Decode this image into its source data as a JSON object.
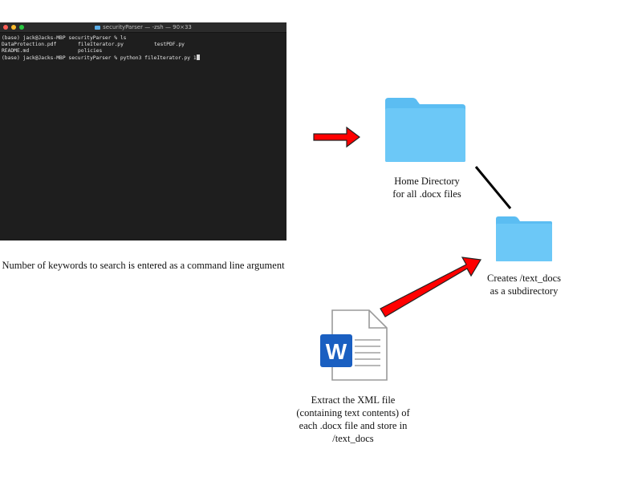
{
  "terminal": {
    "title": "securityParser — -zsh — 90×33",
    "lines": [
      {
        "prompt": "(base) jack@Jacks-MBP securityParser % ls"
      },
      {
        "files": [
          "DataProtection.pdf",
          "fileIterator.py",
          "testPDF.py"
        ]
      },
      {
        "files": [
          "README.md",
          "policies",
          ""
        ]
      },
      {
        "prompt": "(base) jack@Jacks-MBP securityParser % python3 fileIterator.py 1"
      }
    ]
  },
  "captions": {
    "terminal": "Number of keywords to search is entered as a command line argument",
    "home_line1": "Home Directory",
    "home_line2": "for all .docx files",
    "sub_line1": "Creates /text_docs",
    "sub_line2": "as a subdirectory",
    "extract_line1": "Extract the XML file",
    "extract_line2": "(containing text contents) of",
    "extract_line3": "each .docx file and store in",
    "extract_line4": "/text_docs"
  },
  "icons": {
    "home_folder": "folder-icon",
    "sub_folder": "folder-icon",
    "word_doc": "word-document-icon",
    "word_letter": "W"
  },
  "colors": {
    "arrow_fill": "#ff0000",
    "folder": "#6cc8f7",
    "word_blue": "#1a5fc1"
  }
}
